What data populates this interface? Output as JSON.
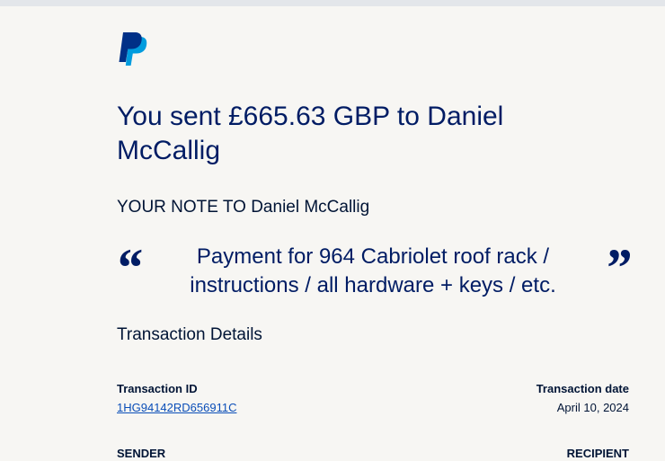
{
  "brand": {
    "logo_icon": "paypal-logo-icon",
    "primary_color": "#003087",
    "secondary_color": "#009cde"
  },
  "headline": "You sent £665.63 GBP to Daniel McCallig",
  "note": {
    "label": "YOUR NOTE TO Daniel McCallig",
    "text": "Payment for 964 Cabriolet roof rack / instructions / all hardware + keys / etc.",
    "open_quote": "“",
    "close_quote": "”"
  },
  "details": {
    "title": "Transaction Details",
    "transaction_id_label": "Transaction ID",
    "transaction_id": "1HG94142RD656911C",
    "transaction_date_label": "Transaction date",
    "transaction_date": "April 10, 2024",
    "sender_label": "SENDER",
    "recipient_label": "RECIPIENT"
  }
}
